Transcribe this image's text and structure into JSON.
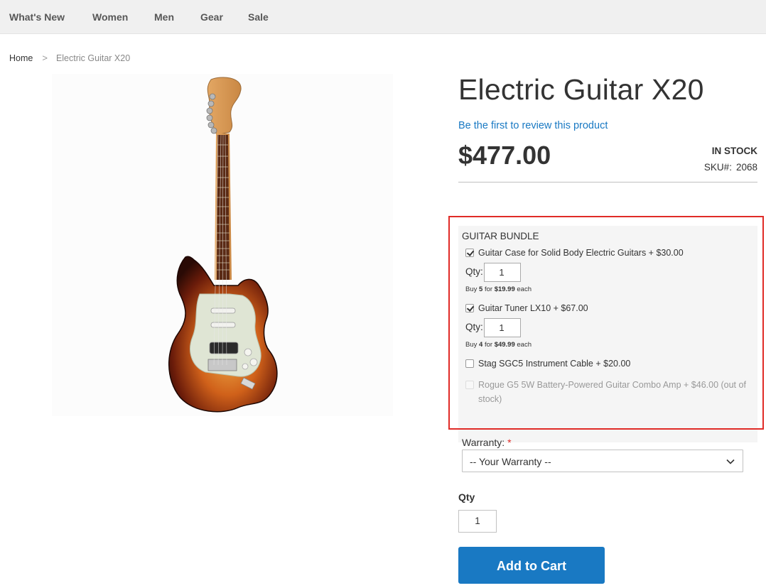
{
  "nav": {
    "items": [
      {
        "label": "What's New"
      },
      {
        "label": "Women"
      },
      {
        "label": "Men"
      },
      {
        "label": "Gear"
      },
      {
        "label": "Sale"
      }
    ]
  },
  "breadcrumb": {
    "home": "Home",
    "separator": ">",
    "current": "Electric Guitar X20"
  },
  "product": {
    "title": "Electric Guitar X20",
    "review_link": "Be the first to review this product",
    "price": "$477.00",
    "stock": "IN STOCK",
    "sku_label": "SKU#:",
    "sku_value": "2068",
    "image_icon": "guitar-image"
  },
  "bundle": {
    "title": "GUITAR BUNDLE",
    "options": [
      {
        "label": "Guitar Case for Solid Body Electric Guitars + $30.00",
        "checked": true
      },
      {
        "label": "Guitar Tuner LX10 + $67.00",
        "checked": true
      },
      {
        "label": "Stag SGC5 Instrument Cable + $20.00",
        "checked": false
      },
      {
        "label": "Rogue G5 5W Battery-Powered Guitar Combo Amp + $46.00 (out of stock)",
        "checked": false,
        "disabled": true
      }
    ],
    "qty_label": "Qty:",
    "option_qty": [
      "1",
      "1"
    ],
    "tiers": [
      {
        "prefix": "Buy",
        "count": "5",
        "mid": "for",
        "price": "$19.99",
        "suffix": "each"
      },
      {
        "prefix": "Buy",
        "count": "4",
        "mid": "for",
        "price": "$49.99",
        "suffix": "each"
      }
    ]
  },
  "warranty": {
    "label": "Warranty:",
    "required_mark": "*",
    "selected": "-- Your Warranty --"
  },
  "purchase": {
    "qty_label": "Qty",
    "qty_value": "1",
    "add_to_cart": "Add to Cart"
  },
  "colors": {
    "accent": "#1979c3",
    "required": "#e02b27",
    "highlight": "#e02b27"
  }
}
